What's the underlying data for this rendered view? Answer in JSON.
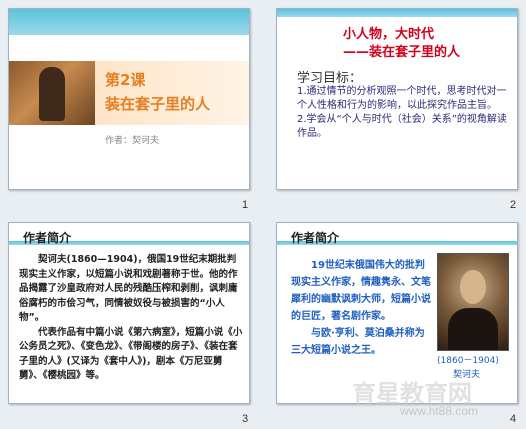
{
  "slides": [
    {
      "number": "1",
      "lesson": "第2课",
      "title": "装在套子里的人",
      "author": "作者：契诃夫"
    },
    {
      "number": "2",
      "heading1": "小人物，大时代",
      "heading2": "——装在套子里的人",
      "goals_title": "学习目标：",
      "goal1": "1.通过情节的分析观照一个时代，思考时代对一个人性格和行为的影响，以此探究作品主旨。",
      "goal2": "2.学会从“个人与时代（社会）关系”的视角解读作品。"
    },
    {
      "number": "3",
      "title": "作者简介",
      "para1": "契诃夫(1860—1904)，俄国19世纪末期批判现实主义作家，以短篇小说和戏剧著称于世。他的作品揭露了沙皇政府对人民的残酷压榨和剥削，讽刺庸俗腐朽的市侩习气，同情被奴役与被损害的“小人物”。",
      "para2": "代表作品有中篇小说《第六病室》，短篇小说《小公务员之死》、《变色龙》、《带阁楼的房子》、《装在套子里的人》(又译为《套中人》)，剧本《万尼亚舅舅》、《樱桃园》等。"
    },
    {
      "number": "4",
      "title": "作者简介",
      "para1": "19世纪末俄国伟大的批判现实主义作家，情趣隽永、文笔犀利的幽默讽刺大师，短篇小说的巨匠，著名剧作家。",
      "para2": "与欧·亨利、莫泊桑并称为三大短篇小说之王。",
      "years": "(1860－1904)",
      "portrait_label": "契诃夫"
    }
  ],
  "watermark": {
    "text": "育星教育网",
    "url": "www.ht88.com"
  }
}
